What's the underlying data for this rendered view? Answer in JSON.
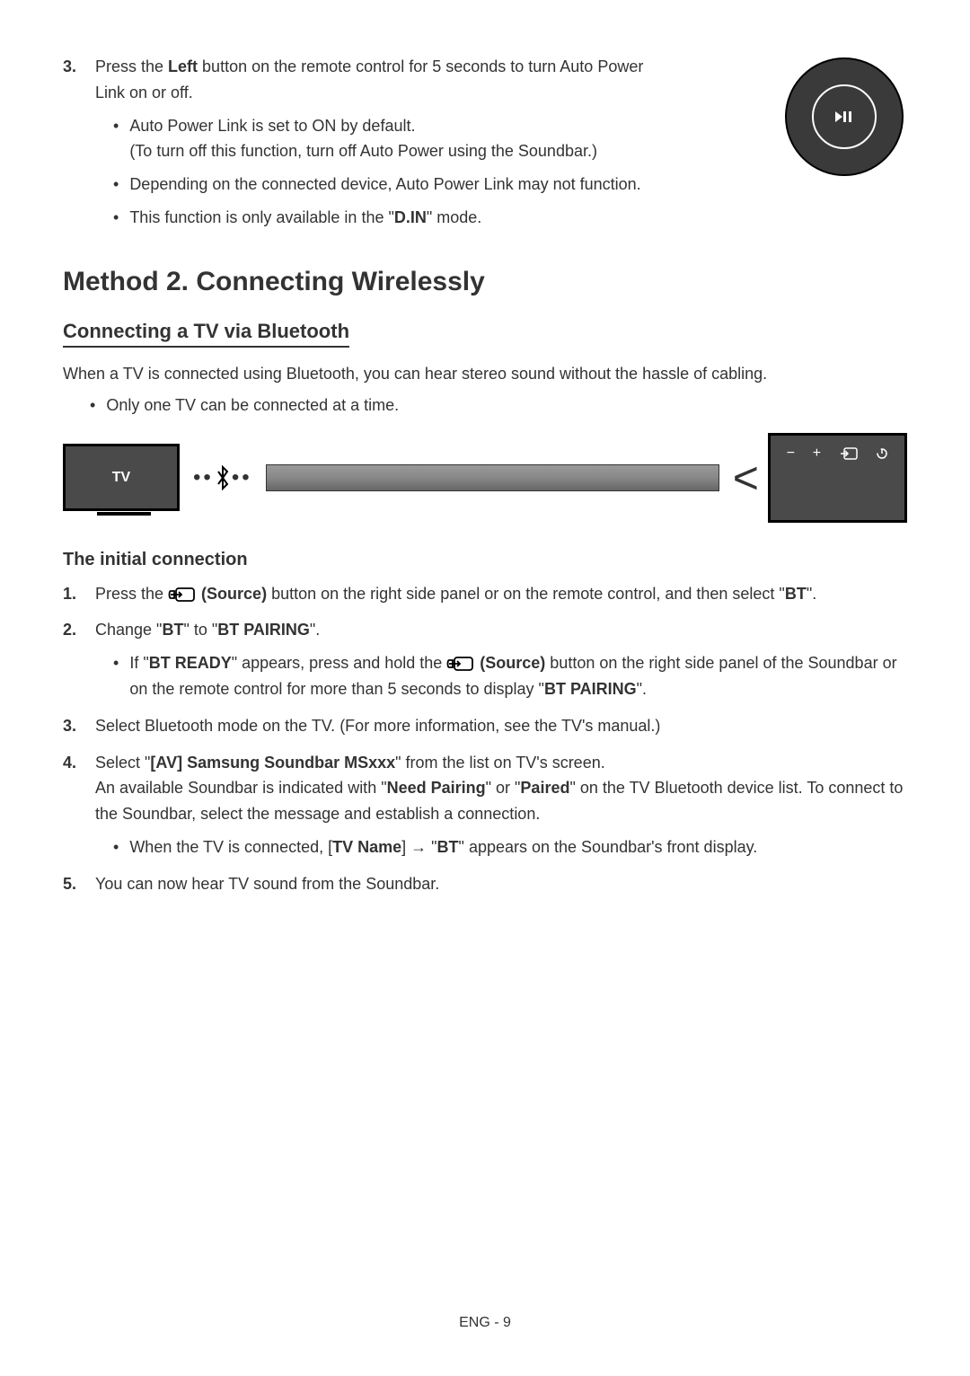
{
  "step3": {
    "num": "3.",
    "text_prefix": "Press the ",
    "text_bold": "Left",
    "text_suffix": " button on the remote control for 5 seconds to turn Auto Power Link on or off.",
    "bullets": [
      {
        "line1": "Auto Power Link is set to ON by default.",
        "line2": "(To turn off this function, turn off Auto Power using the Soundbar.)"
      },
      {
        "line1": "Depending on the connected device, Auto Power Link may not function."
      },
      {
        "prefix": "This function is only available in the \"",
        "bold": "D.IN",
        "suffix": "\" mode."
      }
    ]
  },
  "method2": {
    "heading": "Method 2. Connecting Wirelessly",
    "subheading": "Connecting a TV via Bluetooth",
    "intro": "When a TV is connected using Bluetooth, you can hear stereo sound without the hassle of cabling.",
    "bullet": "Only one TV can be connected at a time."
  },
  "diagram": {
    "tv_label": "TV"
  },
  "initial": {
    "heading": "The initial connection",
    "steps": [
      {
        "num": "1.",
        "parts": [
          "Press the ",
          " (Source)",
          " button on the right side panel or on the remote control, and then select \"",
          "BT",
          "\"."
        ]
      },
      {
        "num": "2.",
        "parts": [
          "Change \"",
          "BT",
          "\" to \"",
          "BT PAIRING",
          "\"."
        ],
        "sub": {
          "parts": [
            "If \"",
            "BT READY",
            "\" appears, press and hold the ",
            " (Source)",
            " button on the right side panel of the Soundbar or on the remote control for more than 5 seconds to display \"",
            "BT PAIRING",
            "\"."
          ]
        }
      },
      {
        "num": "3.",
        "text": "Select Bluetooth mode on the TV. (For more information, see the TV's manual.)"
      },
      {
        "num": "4.",
        "parts": [
          "Select \"",
          "[AV] Samsung Soundbar MSxxx",
          "\" from the list on TV's screen."
        ],
        "line2_parts": [
          "An available Soundbar is indicated with \"",
          "Need Pairing",
          "\" or \"",
          "Paired",
          "\" on the TV Bluetooth device list. To connect to the Soundbar, select the message and establish a connection."
        ],
        "sub": {
          "parts": [
            "When the TV is connected, [",
            "TV Name",
            "] → \"",
            "BT",
            "\" appears on the Soundbar's front display."
          ]
        }
      },
      {
        "num": "5.",
        "text": "You can now hear TV sound from the Soundbar."
      }
    ]
  },
  "footer": "ENG - 9"
}
